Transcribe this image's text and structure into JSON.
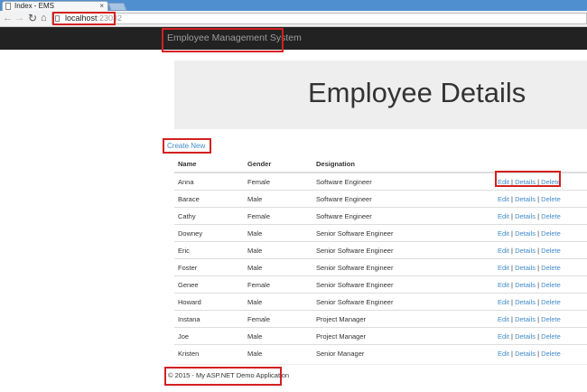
{
  "browser": {
    "tab_title": "Index - EMS",
    "tab_close": "×",
    "url_host": "localhost",
    "url_port": ":23032"
  },
  "navbar": {
    "brand": "Employee Management System"
  },
  "jumbotron": {
    "title": "Employee Details"
  },
  "create_link": "Create New",
  "table": {
    "headers": [
      "Name",
      "Gender",
      "Designation"
    ],
    "actions": {
      "edit": "Edit",
      "details": "Details",
      "delete": "Delete",
      "separator": "|"
    },
    "rows": [
      {
        "name": "Anna",
        "gender": "Female",
        "designation": "Software Engineer"
      },
      {
        "name": "Barace",
        "gender": "Male",
        "designation": "Software Engineer"
      },
      {
        "name": "Cathy",
        "gender": "Female",
        "designation": "Software Engineer"
      },
      {
        "name": "Downey",
        "gender": "Male",
        "designation": "Senior Software Engineer"
      },
      {
        "name": "Eric",
        "gender": "Male",
        "designation": "Senior Software Engineer"
      },
      {
        "name": "Foster",
        "gender": "Male",
        "designation": "Senior Software Engineer"
      },
      {
        "name": "Genee",
        "gender": "Female",
        "designation": "Senior Software Engineer"
      },
      {
        "name": "Howard",
        "gender": "Male",
        "designation": "Senior Software Engineer"
      },
      {
        "name": "Instana",
        "gender": "Female",
        "designation": "Project Manager"
      },
      {
        "name": "Joe",
        "gender": "Male",
        "designation": "Project Manager"
      },
      {
        "name": "Kristen",
        "gender": "Male",
        "designation": "Senior Manager"
      }
    ]
  },
  "footer": {
    "text": "© 2015 - My ASP.NET Demo Application"
  },
  "colors": {
    "navbar_bg": "#222222",
    "link": "#428bca",
    "jumbotron_bg": "#eeeeee",
    "highlight_box": "#d42020"
  },
  "icons": [
    "page-icon",
    "back-arrow-icon",
    "forward-arrow-icon",
    "reload-icon",
    "home-icon",
    "close-icon"
  ]
}
